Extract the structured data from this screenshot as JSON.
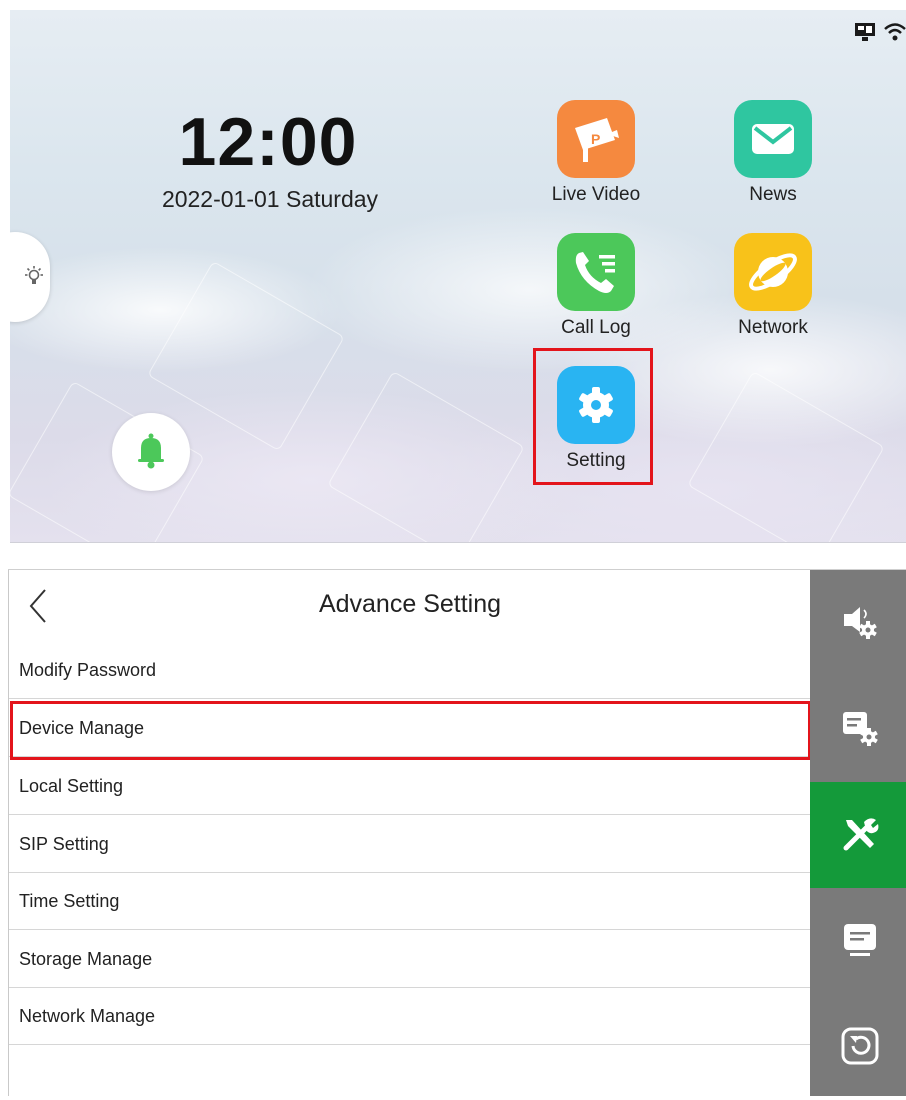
{
  "home": {
    "clock": "12:00",
    "date": "2022-01-01 Saturday",
    "apps": [
      {
        "label": "Live Video",
        "icon": "camera-icon",
        "color": "#f5893f"
      },
      {
        "label": "News",
        "icon": "envelope-icon",
        "color": "#2fc6a0"
      },
      {
        "label": "Call Log",
        "icon": "phone-icon",
        "color": "#4cc85a"
      },
      {
        "label": "Network",
        "icon": "planet-icon",
        "color": "#f8c21a"
      },
      {
        "label": "Setting",
        "icon": "gear-icon",
        "color": "#29b4f2"
      }
    ],
    "status_icons": [
      "ethernet-icon",
      "wifi-icon"
    ]
  },
  "settings": {
    "title": "Advance Setting",
    "items": [
      {
        "label": "Modify Password"
      },
      {
        "label": "Device Manage"
      },
      {
        "label": "Local Setting"
      },
      {
        "label": "SIP Setting"
      },
      {
        "label": "Time Setting"
      },
      {
        "label": "Storage Manage"
      },
      {
        "label": "Network Manage"
      }
    ],
    "sidebar": [
      {
        "icon": "speaker-settings-icon",
        "active": false
      },
      {
        "icon": "monitor-settings-icon",
        "active": false
      },
      {
        "icon": "tools-icon",
        "active": true
      },
      {
        "icon": "message-icon",
        "active": false
      },
      {
        "icon": "restore-icon",
        "active": false
      }
    ]
  },
  "colors": {
    "highlight": "#e3141b",
    "active_tab": "#149a3a",
    "sidebar": "#7a7a7a"
  }
}
